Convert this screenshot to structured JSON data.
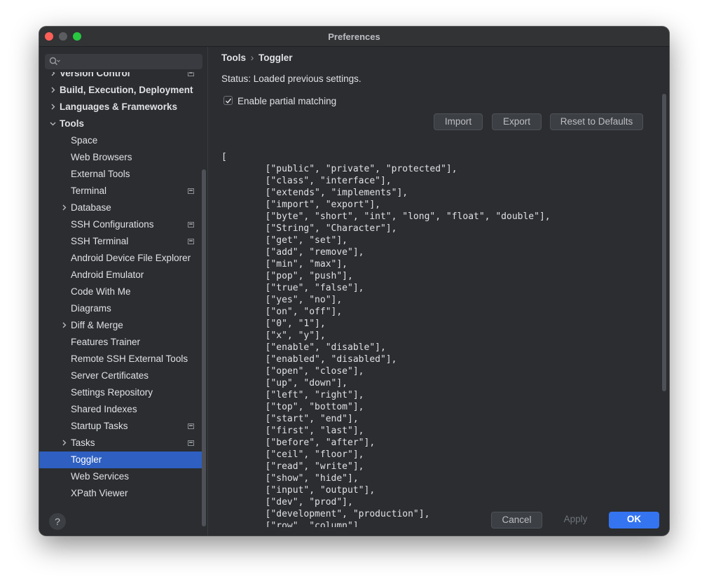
{
  "window": {
    "title": "Preferences"
  },
  "sidebar": {
    "search": {
      "placeholder": "",
      "icon": "search-icon"
    },
    "items": [
      {
        "label": "Version Control",
        "level": 0,
        "bold": true,
        "arrow": true,
        "expanded": false,
        "project_icon": true
      },
      {
        "label": "Build, Execution, Deployment",
        "level": 0,
        "bold": true,
        "arrow": true,
        "expanded": false,
        "project_icon": false
      },
      {
        "label": "Languages & Frameworks",
        "level": 0,
        "bold": true,
        "arrow": true,
        "expanded": false,
        "project_icon": false
      },
      {
        "label": "Tools",
        "level": 0,
        "bold": true,
        "arrow": true,
        "expanded": true,
        "project_icon": false
      },
      {
        "label": "Space",
        "level": 1,
        "bold": false,
        "arrow": false,
        "project_icon": false
      },
      {
        "label": "Web Browsers",
        "level": 1,
        "bold": false,
        "arrow": false,
        "project_icon": false
      },
      {
        "label": "External Tools",
        "level": 1,
        "bold": false,
        "arrow": false,
        "project_icon": false
      },
      {
        "label": "Terminal",
        "level": 1,
        "bold": false,
        "arrow": false,
        "project_icon": true
      },
      {
        "label": "Database",
        "level": 1,
        "bold": false,
        "arrow": true,
        "expanded": false,
        "project_icon": false
      },
      {
        "label": "SSH Configurations",
        "level": 1,
        "bold": false,
        "arrow": false,
        "project_icon": true
      },
      {
        "label": "SSH Terminal",
        "level": 1,
        "bold": false,
        "arrow": false,
        "project_icon": true
      },
      {
        "label": "Android Device File Explorer",
        "level": 1,
        "bold": false,
        "arrow": false,
        "project_icon": false
      },
      {
        "label": "Android Emulator",
        "level": 1,
        "bold": false,
        "arrow": false,
        "project_icon": false
      },
      {
        "label": "Code With Me",
        "level": 1,
        "bold": false,
        "arrow": false,
        "project_icon": false
      },
      {
        "label": "Diagrams",
        "level": 1,
        "bold": false,
        "arrow": false,
        "project_icon": false
      },
      {
        "label": "Diff & Merge",
        "level": 1,
        "bold": false,
        "arrow": true,
        "expanded": false,
        "project_icon": false
      },
      {
        "label": "Features Trainer",
        "level": 1,
        "bold": false,
        "arrow": false,
        "project_icon": false
      },
      {
        "label": "Remote SSH External Tools",
        "level": 1,
        "bold": false,
        "arrow": false,
        "project_icon": false
      },
      {
        "label": "Server Certificates",
        "level": 1,
        "bold": false,
        "arrow": false,
        "project_icon": false
      },
      {
        "label": "Settings Repository",
        "level": 1,
        "bold": false,
        "arrow": false,
        "project_icon": false
      },
      {
        "label": "Shared Indexes",
        "level": 1,
        "bold": false,
        "arrow": false,
        "project_icon": false
      },
      {
        "label": "Startup Tasks",
        "level": 1,
        "bold": false,
        "arrow": false,
        "project_icon": true
      },
      {
        "label": "Tasks",
        "level": 1,
        "bold": false,
        "arrow": true,
        "expanded": false,
        "project_icon": true
      },
      {
        "label": "Toggler",
        "level": 1,
        "bold": false,
        "arrow": false,
        "project_icon": false,
        "selected": true
      },
      {
        "label": "Web Services",
        "level": 1,
        "bold": false,
        "arrow": false,
        "project_icon": false
      },
      {
        "label": "XPath Viewer",
        "level": 1,
        "bold": false,
        "arrow": false,
        "project_icon": false
      }
    ]
  },
  "breadcrumb": {
    "parent": "Tools",
    "separator": "›",
    "current": "Toggler"
  },
  "status_text": "Status: Loaded previous settings.",
  "options": {
    "partial_matching_label": "Enable partial matching",
    "partial_matching_checked": true
  },
  "buttons": {
    "import": "Import",
    "export": "Export",
    "reset": "Reset to Defaults"
  },
  "editor": {
    "content": "[\n        [\"public\", \"private\", \"protected\"],\n        [\"class\", \"interface\"],\n        [\"extends\", \"implements\"],\n        [\"import\", \"export\"],\n        [\"byte\", \"short\", \"int\", \"long\", \"float\", \"double\"],\n        [\"String\", \"Character\"],\n        [\"get\", \"set\"],\n        [\"add\", \"remove\"],\n        [\"min\", \"max\"],\n        [\"pop\", \"push\"],\n        [\"true\", \"false\"],\n        [\"yes\", \"no\"],\n        [\"on\", \"off\"],\n        [\"0\", \"1\"],\n        [\"x\", \"y\"],\n        [\"enable\", \"disable\"],\n        [\"enabled\", \"disabled\"],\n        [\"open\", \"close\"],\n        [\"up\", \"down\"],\n        [\"left\", \"right\"],\n        [\"top\", \"bottom\"],\n        [\"start\", \"end\"],\n        [\"first\", \"last\"],\n        [\"before\", \"after\"],\n        [\"ceil\", \"floor\"],\n        [\"read\", \"write\"],\n        [\"show\", \"hide\"],\n        [\"input\", \"output\"],\n        [\"dev\", \"prod\"],\n        [\"development\", \"production\"],\n        [\"row\", \"column\"]"
  },
  "footer": {
    "help": "?",
    "cancel": "Cancel",
    "apply": "Apply",
    "ok": "OK"
  },
  "colors": {
    "accent": "#3574f0",
    "selection": "#2e5fc1",
    "background": "#2b2d30",
    "text": "#dfe1e5"
  }
}
